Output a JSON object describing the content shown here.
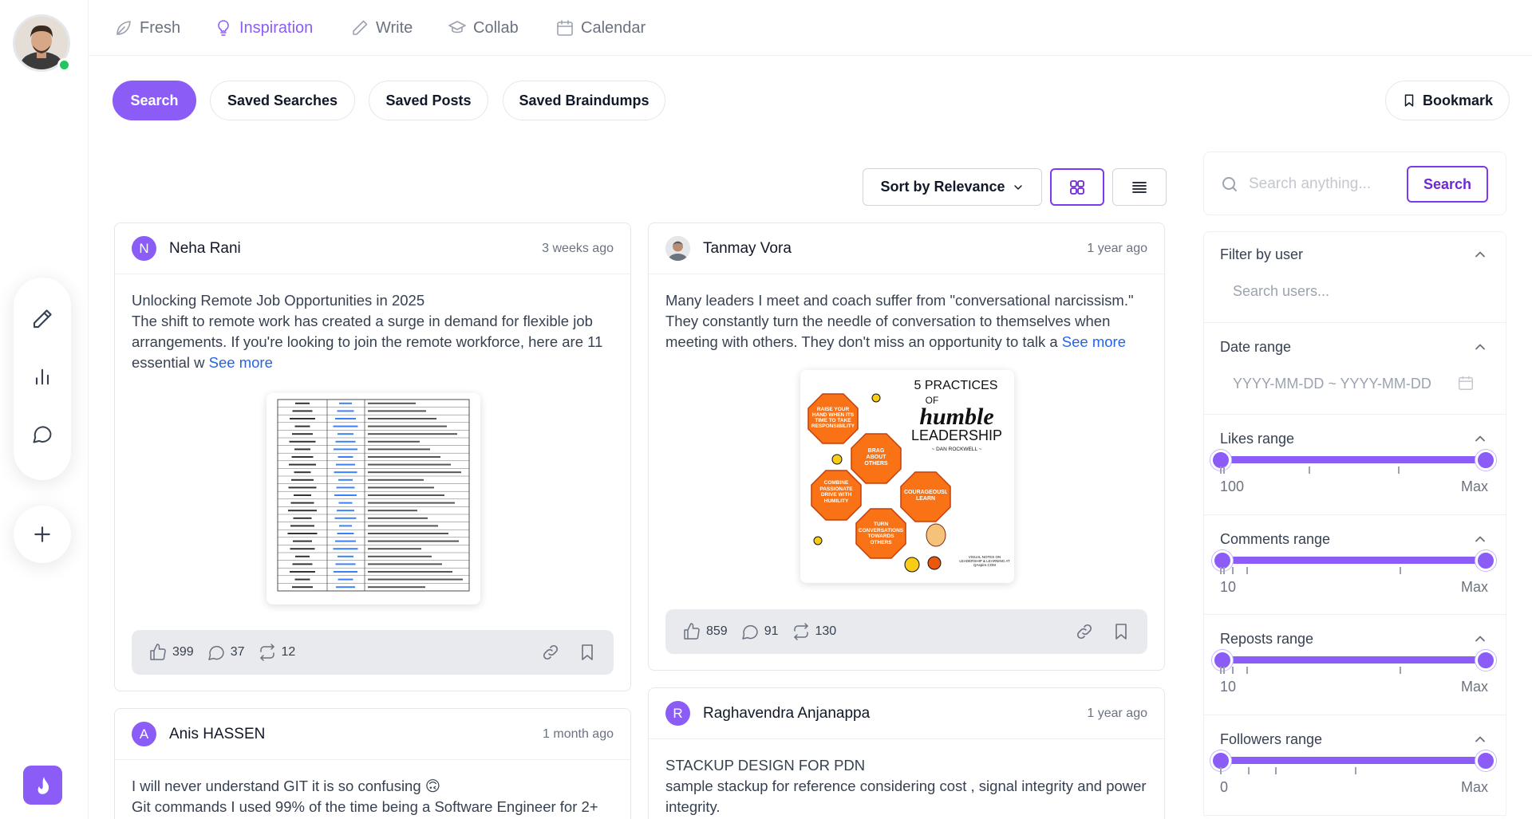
{
  "nav": {
    "items": [
      {
        "label": "Fresh",
        "icon": "leaf-icon"
      },
      {
        "label": "Inspiration",
        "icon": "lightbulb-icon",
        "active": true
      },
      {
        "label": "Write",
        "icon": "pencil-icon"
      },
      {
        "label": "Collab",
        "icon": "graduation-cap-icon"
      },
      {
        "label": "Calendar",
        "icon": "calendar-icon"
      }
    ]
  },
  "tabs": [
    "Search",
    "Saved Searches",
    "Saved Posts",
    "Saved Braindumps"
  ],
  "bookmark_label": "Bookmark",
  "sort_label": "Sort by Relevance",
  "accent_color": "#8b5cf6",
  "search": {
    "placeholder": "Search anything...",
    "button": "Search"
  },
  "filters": {
    "user": {
      "title": "Filter by user",
      "placeholder": "Search users..."
    },
    "date": {
      "title": "Date range",
      "placeholder": "YYYY-MM-DD ~ YYYY-MM-DD"
    },
    "likes": {
      "title": "Likes range",
      "min": "100",
      "max": "Max"
    },
    "comments": {
      "title": "Comments range",
      "min": "10",
      "max": "Max"
    },
    "reposts": {
      "title": "Reposts range",
      "min": "10",
      "max": "Max"
    },
    "followers": {
      "title": "Followers range",
      "min": "0",
      "max": "Max"
    }
  },
  "posts": [
    {
      "author": "Neha Rani",
      "initial": "N",
      "time": "3 weeks ago",
      "lines": [
        "Unlocking Remote Job Opportunities in 2025",
        "The shift to remote work has created a surge in demand for flexible job arrangements. If you're looking to join the remote workforce, here are 11 essential w"
      ],
      "see_more": "See more",
      "likes": "399",
      "comments": "37",
      "reposts": "12"
    },
    {
      "author": "Tanmay Vora",
      "time": "1 year ago",
      "lines": [
        "Many leaders I meet and coach suffer from \"conversational narcissism.\" They constantly turn the needle of conversation to themselves when meeting with others. They don't miss an opportunity to talk a"
      ],
      "see_more": "See more",
      "likes": "859",
      "comments": "91",
      "reposts": "130",
      "image": {
        "title_1": "5 PRACTICES",
        "title_2": "OF",
        "title_3": "humble",
        "title_4": "LEADERSHIP",
        "byline": "~ DAN ROCKWELL ~",
        "hex_1": "RAISE YOUR HAND WHEN ITS TIME TO TAKE RESPONSIBILITY",
        "hex_2": "BRAG ABOUT OTHERS",
        "hex_3": "COMBINE PASSIONATE DRIVE WITH HUMILITY",
        "hex_4": "COURAGEOUSLY LEARN",
        "hex_5": "TURN CONVERSATIONS TOWARDS OTHERS",
        "footer": "VISUAL NOTES ON LEADERSHIP & LEARNING AT QAspire.COM"
      }
    },
    {
      "author": "Anis HASSEN",
      "initial": "A",
      "time": "1 month ago",
      "lines": [
        "I will never understand GIT it is so confusing 🙃",
        "Git commands I used 99% of the time being a Software Engineer for 2+"
      ]
    },
    {
      "author": "Raghavendra Anjanappa",
      "initial": "R",
      "time": "1 year ago",
      "lines": [
        "STACKUP DESIGN FOR PDN",
        "sample stackup for reference considering cost , signal integrity and power integrity."
      ]
    }
  ]
}
